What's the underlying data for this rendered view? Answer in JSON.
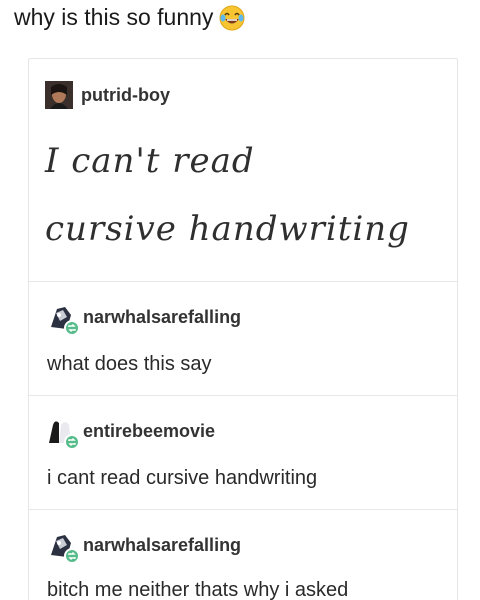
{
  "caption": {
    "text": "why is this so funny",
    "emoji": "laughing-tears-emoji"
  },
  "posts": [
    {
      "username": "putrid-boy",
      "lines": [
        "I can't read",
        "cursive handwriting"
      ],
      "reblog": false
    },
    {
      "username": "narwhalsarefalling",
      "text": "what does this say",
      "reblog": true
    },
    {
      "username": "entirebeemovie",
      "text": "i cant read cursive handwriting",
      "reblog": true
    },
    {
      "username": "narwhalsarefalling",
      "text": "bitch me neither thats why i asked",
      "reblog": true
    }
  ],
  "colors": {
    "reblog_badge": "#56bc8a",
    "divider": "#e8e8e8"
  }
}
